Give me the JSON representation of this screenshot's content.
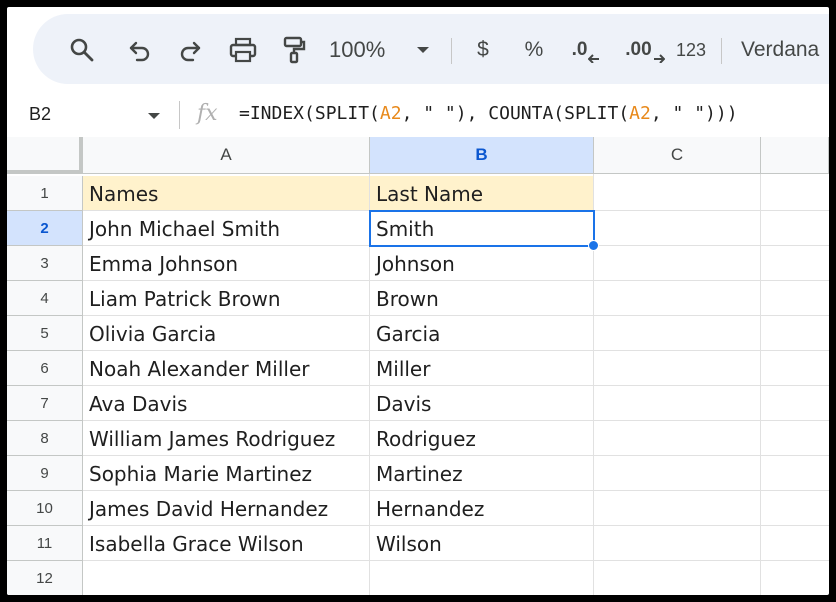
{
  "toolbar": {
    "zoom": "100%",
    "currency_label": "$",
    "percent_label": "%",
    "dec_decrease_label": ".0",
    "dec_increase_label": ".00",
    "number_format_label": "123",
    "font_name": "Verdana"
  },
  "formula_bar": {
    "cell_ref": "B2",
    "fx_label": "fx",
    "formula_parts": [
      "=INDEX(SPLIT(",
      "A2",
      ", \" \"), COUNTA(SPLIT(",
      "A2",
      ", \" \")))"
    ]
  },
  "columns": [
    "A",
    "B",
    "C"
  ],
  "rows": [
    {
      "num": "1",
      "a": "Names",
      "b": "Last Name"
    },
    {
      "num": "2",
      "a": "John Michael Smith",
      "b": "Smith"
    },
    {
      "num": "3",
      "a": "Emma Johnson",
      "b": "Johnson"
    },
    {
      "num": "4",
      "a": "Liam Patrick Brown",
      "b": "Brown"
    },
    {
      "num": "5",
      "a": "Olivia Garcia",
      "b": "Garcia"
    },
    {
      "num": "6",
      "a": "Noah Alexander Miller",
      "b": "Miller"
    },
    {
      "num": "7",
      "a": "Ava Davis",
      "b": "Davis"
    },
    {
      "num": "8",
      "a": "William James Rodriguez",
      "b": "Rodriguez"
    },
    {
      "num": "9",
      "a": "Sophia Marie Martinez",
      "b": "Martinez"
    },
    {
      "num": "10",
      "a": "James David Hernandez",
      "b": "Hernandez"
    },
    {
      "num": "11",
      "a": "Isabella Grace Wilson",
      "b": "Wilson"
    },
    {
      "num": "12",
      "a": "",
      "b": ""
    }
  ],
  "colors": {
    "header_fill": "#fff2cc",
    "selection": "#1a73e8",
    "selected_header": "#d3e3fd"
  }
}
